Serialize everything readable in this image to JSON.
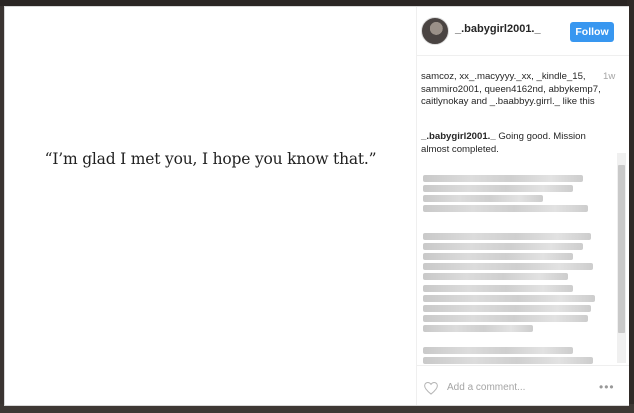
{
  "photo": {
    "quote": "“I’m glad I met you, I hope you know that.”"
  },
  "post": {
    "username": "_.babygirl2001._",
    "follow_label": "Follow",
    "likes_text": "samcoz, xx_.macyyyy._xx, _kindle_15, sammiro2001, queen4162nd, abbykemp7, caitlynokay and _.baabbyy.girrl._ like this",
    "time_ago": "1w",
    "caption_user": "_.babygirl2001._",
    "caption_text": "Going good. Mission almost completed.",
    "add_comment_placeholder": "Add a comment...",
    "more_label": "•••"
  },
  "colors": {
    "accent": "#3897f0",
    "text": "#262626",
    "muted": "#a5a5a5"
  },
  "icons": {
    "like": "heart-icon",
    "options": "more-options-icon"
  }
}
